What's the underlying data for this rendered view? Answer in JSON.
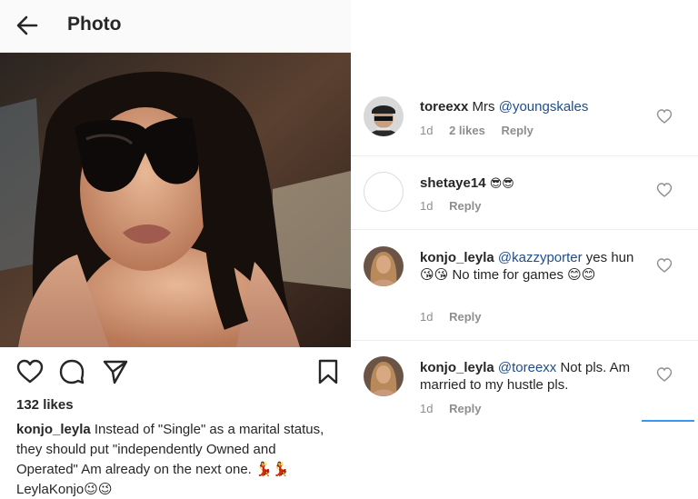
{
  "header": {
    "title": "Photo",
    "back_icon": "arrow-left-icon"
  },
  "post": {
    "likes": "132 likes",
    "caption_user": "konjo_leyla",
    "caption_text": " Instead of \"Single\" as a marital status, they should put \"independently Owned and Operated\" Am already on the next one. 💃💃 LeylaKonjo😉😉",
    "action_icons": [
      "heart-icon",
      "comment-icon",
      "share-icon",
      "bookmark-icon"
    ]
  },
  "comments": [
    {
      "user": "toreexx",
      "mention": "Mrs ",
      "mention_handle": "@youngskales",
      "text": "",
      "time": "1d",
      "likes": "2 likes",
      "reply": "Reply"
    },
    {
      "user": "shetaye14",
      "mention": "",
      "mention_handle": "",
      "text": " 😎😎",
      "time": "1d",
      "likes": "",
      "reply": "Reply"
    },
    {
      "user": "konjo_leyla",
      "mention": " ",
      "mention_handle": "@kazzyporter",
      "text": " yes hun 😘😘 No time for games 😊😊",
      "time": "1d",
      "likes": "",
      "reply": "Reply"
    },
    {
      "user": "konjo_leyla",
      "mention": " ",
      "mention_handle": "@toreexx",
      "text": "  Not pls. Am married to my hustle pls.",
      "time": "1d",
      "likes": "",
      "reply": "Reply"
    }
  ],
  "colors": {
    "text": "#262626",
    "muted": "#8e8e8e",
    "mention": "#1e4e8c",
    "accent": "#3897f0"
  }
}
